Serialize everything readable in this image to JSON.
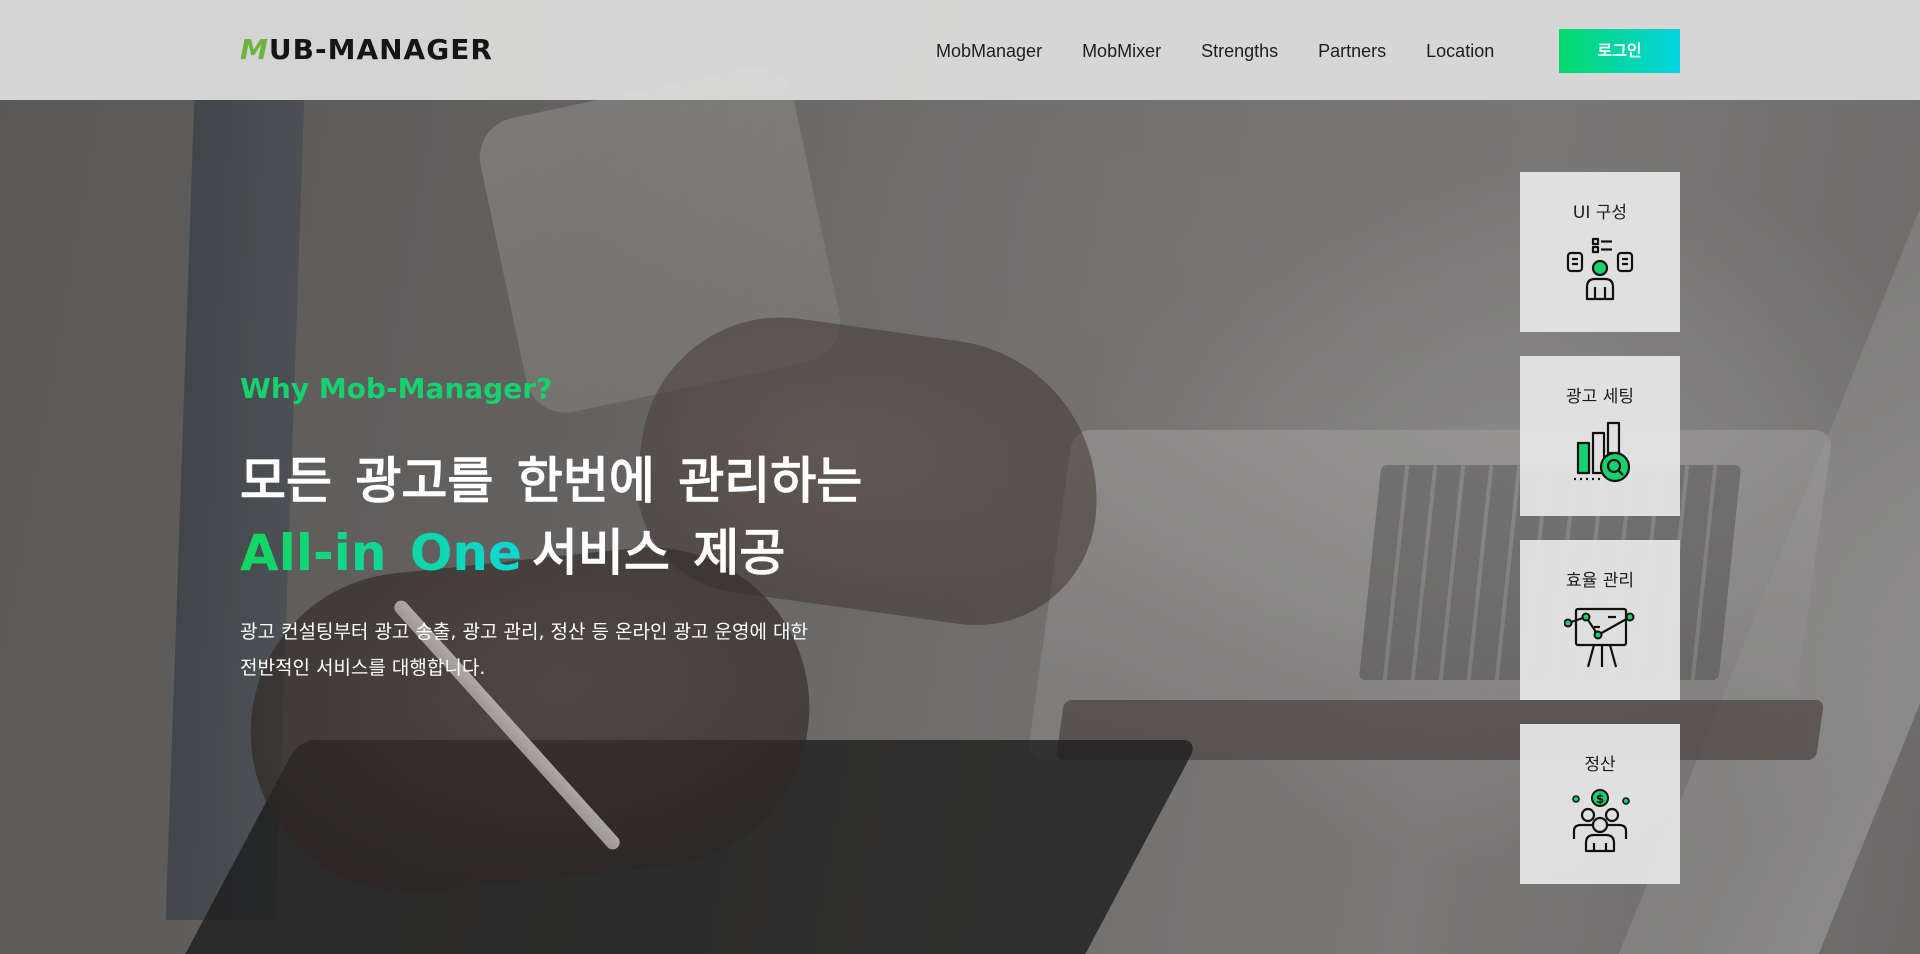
{
  "header": {
    "logo_first": "M",
    "logo_rest": "UB-MANAGER",
    "nav": [
      {
        "label": "MobManager"
      },
      {
        "label": "MobMixer"
      },
      {
        "label": "Strengths"
      },
      {
        "label": "Partners"
      },
      {
        "label": "Location"
      }
    ],
    "login_label": "로그인"
  },
  "hero": {
    "eyebrow": "Why Mob-Manager?",
    "headline_line1": "모든 광고를 한번에 관리하는",
    "headline_highlight": "All-in One",
    "headline_line2_rest": "서비스 제공",
    "desc_line1": "광고 컨설팅부터 광고 송출, 광고 관리, 정산 등 온라인 광고 운영에 대한",
    "desc_line2": "전반적인 서비스를 대행합니다."
  },
  "cards": [
    {
      "label": "UI 구성",
      "icon": "ui-layout-person-icon"
    },
    {
      "label": "광고 세팅",
      "icon": "bar-chart-search-icon"
    },
    {
      "label": "효율 관리",
      "icon": "presentation-board-icon"
    },
    {
      "label": "정산",
      "icon": "team-dollar-icon"
    }
  ],
  "colors": {
    "accent_green": "#16d26e",
    "accent_cyan": "#04d4e0",
    "header_bg": "#dedede"
  }
}
